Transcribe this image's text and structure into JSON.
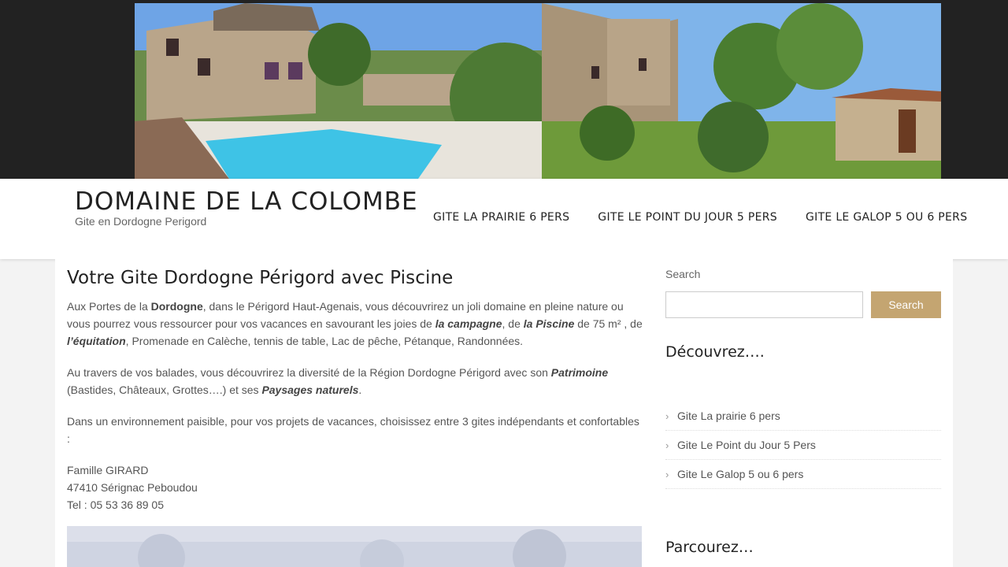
{
  "site": {
    "title": "DOMAINE DE LA COLOMBE",
    "tagline": "Gite en Dordogne Perigord"
  },
  "nav": [
    {
      "label": "GITE LA PRAIRIE 6 PERS"
    },
    {
      "label": "GITE LE POINT DU JOUR 5 PERS"
    },
    {
      "label": "GITE LE GALOP 5 OU 6 PERS"
    }
  ],
  "post": {
    "title": "Votre Gite Dordogne Périgord avec Piscine",
    "p1": {
      "t1": "Aux Portes de la ",
      "b1": "Dordogne",
      "t2": ", dans le Périgord Haut-Agenais, vous découvrirez un joli domaine en pleine nature ou vous pourrez vous ressourcer pour vos vacances en savourant les joies de ",
      "bi1": "la campagne",
      "t3": ", de ",
      "bi2": "la Piscine",
      "t4": " de 75 m² , de ",
      "bi3": "l’équitation",
      "t5": ", Promenade en Calèche, tennis de table, Lac de pêche, Pétanque, Randonnées."
    },
    "p2": {
      "t1": "Au travers de vos balades, vous découvrirez la diversité de la Région Dordogne Périgord avec son ",
      "bi1": "Patrimoine",
      "t2": " (Bastides, Châteaux, Grottes….) et ses ",
      "bi2": "Paysages naturels",
      "t3": "."
    },
    "p3": "Dans un environnement paisible, pour vos projets de vacances, choisissez entre 3 gites indépendants et confortables :",
    "contact": {
      "name": "Famille GIRARD",
      "address": "47410 Sérignac Peboudou",
      "phone": "Tel : 05 53 36 89 05"
    }
  },
  "sidebar": {
    "search_label": "Search",
    "search_value": "",
    "search_button": "Search",
    "discover_title": "Découvrez….",
    "discover_items": [
      {
        "label": "Gite La prairie 6 pers"
      },
      {
        "label": "Gite Le Point du Jour 5 Pers"
      },
      {
        "label": "Gite Le Galop 5 ou 6 pers"
      }
    ],
    "browse_title": "Parcourez…"
  },
  "icons": {
    "list_bullet": "chevron-right-icon"
  },
  "colors": {
    "accent": "#c4a571",
    "header_band": "#222222"
  }
}
